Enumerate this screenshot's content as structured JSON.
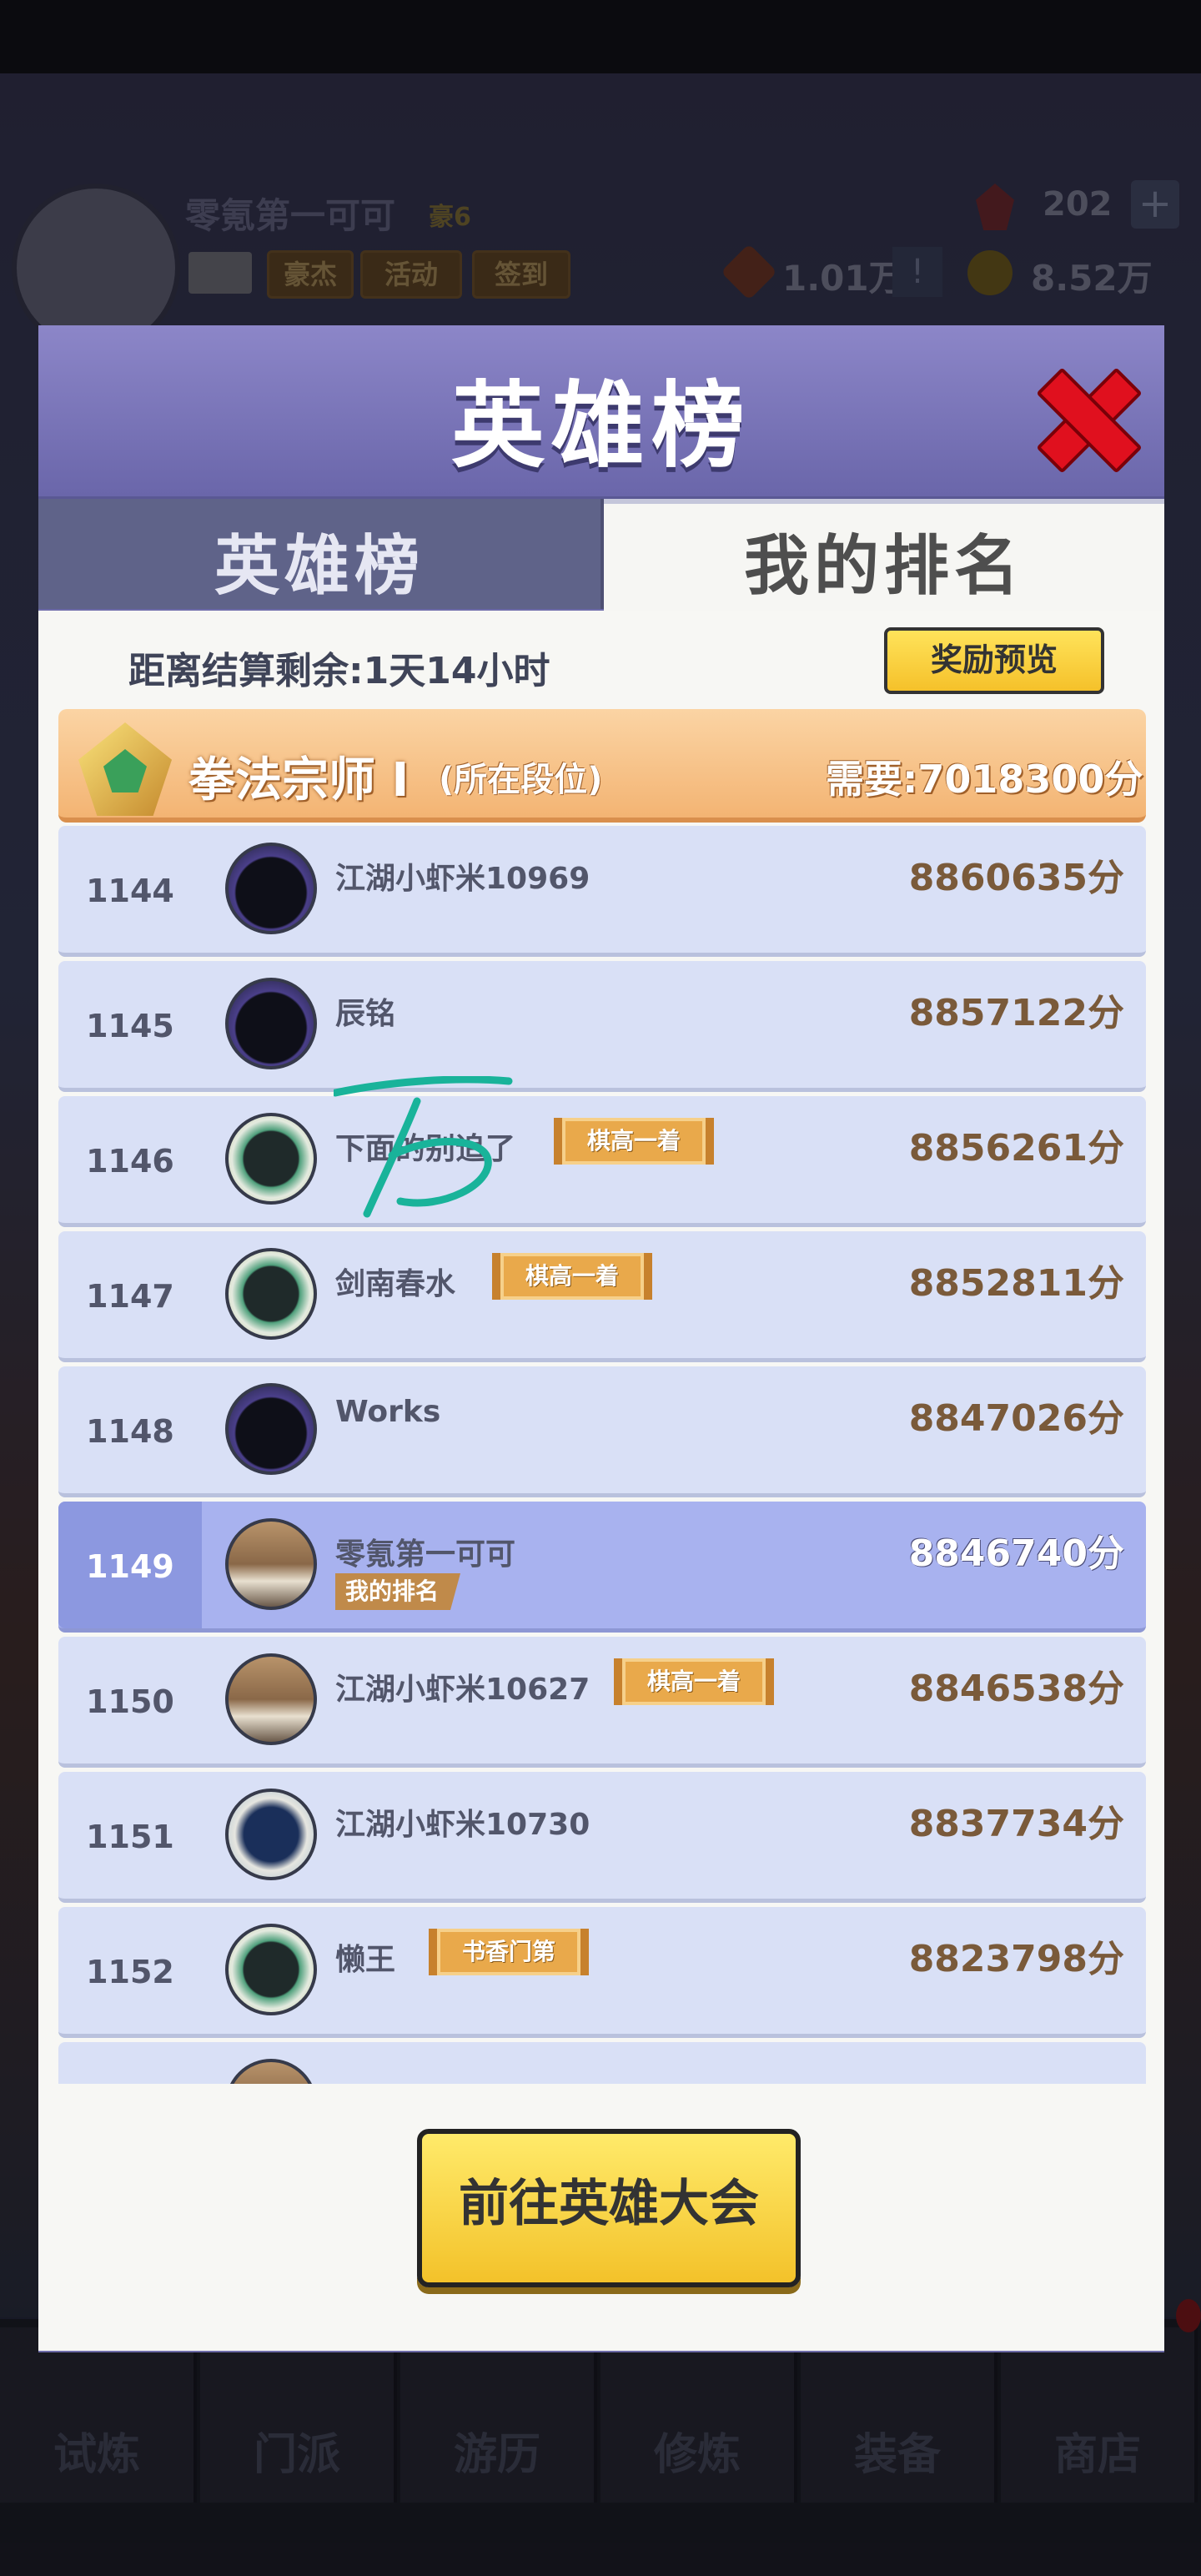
{
  "background": {
    "player_name": "零氪第一可可",
    "vip": "豪6",
    "buttons": [
      "豪杰",
      "活动",
      "签到"
    ],
    "gems": "202",
    "plus": "+",
    "currency1": "1.01万",
    "alert": "!",
    "currency2": "8.52万",
    "nav": [
      "试炼",
      "门派",
      "游历",
      "修炼",
      "装备",
      "商店"
    ]
  },
  "modal": {
    "title": "英雄榜",
    "tabs": [
      "英雄榜",
      "我的排名"
    ],
    "countdown": "距离结算剩余:1天14小时",
    "reward_preview": "奖励预览",
    "tier": {
      "name": "拳法宗师 I",
      "sub": "(所在段位)",
      "requirement": "需要:7018300分"
    },
    "rows": [
      {
        "rank": "1144",
        "name": "江湖小虾米10969",
        "score": "8860635分",
        "tag": ""
      },
      {
        "rank": "1145",
        "name": "辰铭",
        "score": "8857122分",
        "tag": ""
      },
      {
        "rank": "1146",
        "name": "下面的别追了",
        "score": "8856261分",
        "tag": "棋高一着"
      },
      {
        "rank": "1147",
        "name": "剑南春水",
        "score": "8852811分",
        "tag": "棋高一着"
      },
      {
        "rank": "1148",
        "name": "Works",
        "score": "8847026分",
        "tag": ""
      },
      {
        "rank": "1149",
        "name": "零氪第一可可",
        "score": "8846740分",
        "tag": "",
        "me_label": "我的排名"
      },
      {
        "rank": "1150",
        "name": "江湖小虾米10627",
        "score": "8846538分",
        "tag": "棋高一着"
      },
      {
        "rank": "1151",
        "name": "江湖小虾米10730",
        "score": "8837734分",
        "tag": ""
      },
      {
        "rank": "1152",
        "name": "懒王",
        "score": "8823798分",
        "tag": "书香门第"
      }
    ],
    "go_button": "前往英雄大会"
  }
}
